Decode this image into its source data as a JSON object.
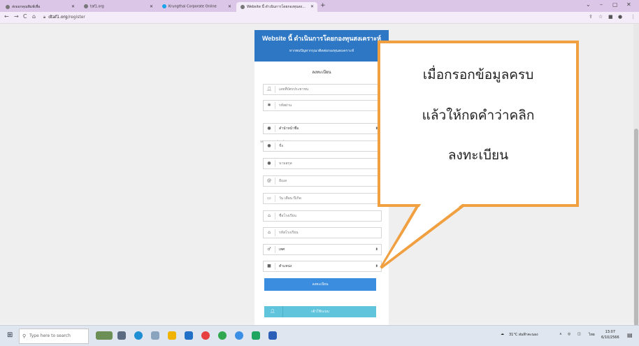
{
  "browser": {
    "tabs": [
      {
        "label": "ส่งออกคุณพิมพ์เพื่อ",
        "active": false
      },
      {
        "label": "taf1.org",
        "active": false
      },
      {
        "label": "Krungthai Corporate Online",
        "active": false
      },
      {
        "label": "Website นี้ ดำเนินการโดยกองทุนสง...",
        "active": true
      }
    ],
    "url_host": "dtaf1.org",
    "url_path": "/register"
  },
  "form": {
    "header_title": "Website นี้ ดำเนินการโดยกองทุนสงเคราะห์",
    "header_subtitle": "หากพบปัญหากรุณาติดต่อกองทุนสงเคราะห์",
    "section_title": "ลงทะเบียน",
    "fields": {
      "id_card_placeholder": "เลขที่บัตรประชาชน",
      "password_placeholder": "รหัสผ่าน",
      "password_note": "รหัสผ่านอย่างน้อย 6 ตัวอักษร",
      "title_select": "คำนำหน้าชื่อ",
      "first_name_placeholder": "ชื่อ",
      "last_name_placeholder": "นามสกุล",
      "email_placeholder": "อีเมล",
      "birthdate_placeholder": "วัน เดือน ปีเกิด",
      "school_name_placeholder": "ชื่อโรงเรียน",
      "school_code_placeholder": "รหัสโรงเรียน",
      "gender_select": "เพศ",
      "position_select": "ตำแหน่ง"
    },
    "register_button": "ลงทะเบียน",
    "login_button": "เข้าใช้ระบบ"
  },
  "callout": {
    "line1": "เมื่อกรอกข้อมูลครบ",
    "line2": "แล้วให้กดคำว่าคลิก",
    "line3": "ลงทะเบียน",
    "border_color": "#f0a040"
  },
  "taskbar": {
    "search_placeholder": "Type here to search",
    "weather": "31°C ฝนฟ้าคะนอง",
    "lang": "ไทย",
    "time": "13:07",
    "date": "6/10/2566"
  }
}
